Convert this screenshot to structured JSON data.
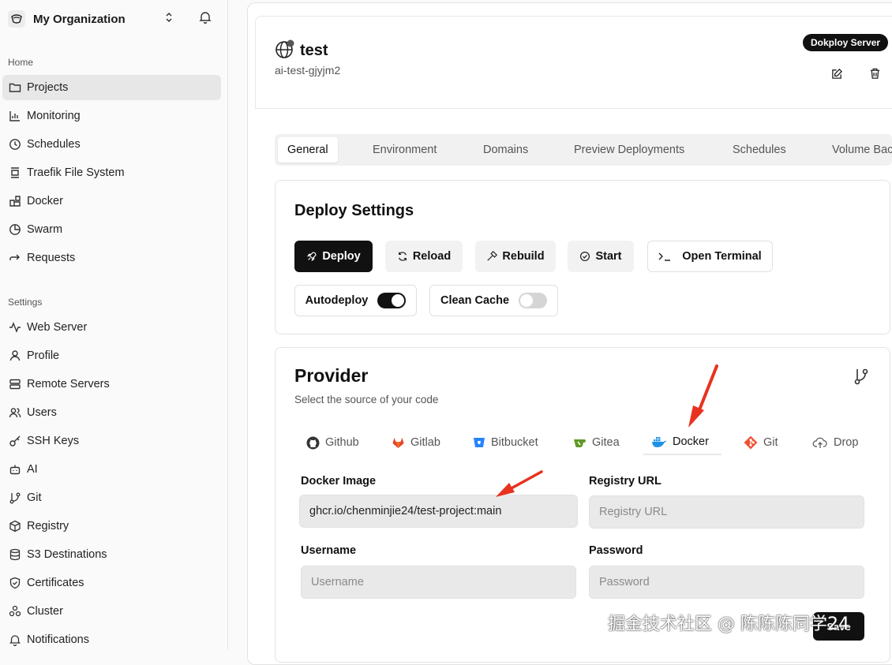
{
  "sidebar": {
    "org_name": "My Organization",
    "sections": {
      "home": "Home",
      "settings": "Settings"
    },
    "home_items": [
      {
        "label": "Projects",
        "icon": "folder-icon",
        "active": true
      },
      {
        "label": "Monitoring",
        "icon": "chart-icon"
      },
      {
        "label": "Schedules",
        "icon": "clock-icon"
      },
      {
        "label": "Traefik File System",
        "icon": "file-system-icon"
      },
      {
        "label": "Docker",
        "icon": "blocks-icon"
      },
      {
        "label": "Swarm",
        "icon": "swarm-icon"
      },
      {
        "label": "Requests",
        "icon": "arrow-right-icon"
      }
    ],
    "settings_items": [
      {
        "label": "Web Server",
        "icon": "activity-icon"
      },
      {
        "label": "Profile",
        "icon": "user-icon"
      },
      {
        "label": "Remote Servers",
        "icon": "server-icon"
      },
      {
        "label": "Users",
        "icon": "users-icon"
      },
      {
        "label": "SSH Keys",
        "icon": "key-icon"
      },
      {
        "label": "AI",
        "icon": "bot-icon"
      },
      {
        "label": "Git",
        "icon": "git-branch-icon"
      },
      {
        "label": "Registry",
        "icon": "package-icon"
      },
      {
        "label": "S3 Destinations",
        "icon": "database-icon"
      },
      {
        "label": "Certificates",
        "icon": "shield-icon"
      },
      {
        "label": "Cluster",
        "icon": "cluster-icon"
      },
      {
        "label": "Notifications",
        "icon": "bell-icon"
      }
    ]
  },
  "header": {
    "title": "test",
    "subtitle": "ai-test-gjyjm2",
    "server_badge": "Dokploy Server"
  },
  "tabs": [
    "General",
    "Environment",
    "Domains",
    "Preview Deployments",
    "Schedules",
    "Volume Backups"
  ],
  "deploy": {
    "title": "Deploy Settings",
    "deploy_label": "Deploy",
    "reload_label": "Reload",
    "rebuild_label": "Rebuild",
    "start_label": "Start",
    "terminal_label": "Open Terminal",
    "autodeploy_label": "Autodeploy",
    "autodeploy_on": true,
    "clean_cache_label": "Clean Cache",
    "clean_cache_on": false
  },
  "provider": {
    "title": "Provider",
    "description": "Select the source of your code",
    "tabs": [
      "Github",
      "Gitlab",
      "Bitbucket",
      "Gitea",
      "Docker",
      "Git",
      "Drop"
    ],
    "active_tab": "Docker",
    "docker_image_label": "Docker Image",
    "docker_image_value": "ghcr.io/chenminjie24/test-project:main",
    "registry_url_label": "Registry URL",
    "registry_url_placeholder": "Registry URL",
    "username_label": "Username",
    "username_placeholder": "Username",
    "password_label": "Password",
    "password_placeholder": "Password",
    "save_label": "Save"
  },
  "watermark": "掘金技术社区 @ 陈陈陈同学24",
  "colors": {
    "accent": "#111111",
    "annotation_arrow": "#e8321f"
  }
}
